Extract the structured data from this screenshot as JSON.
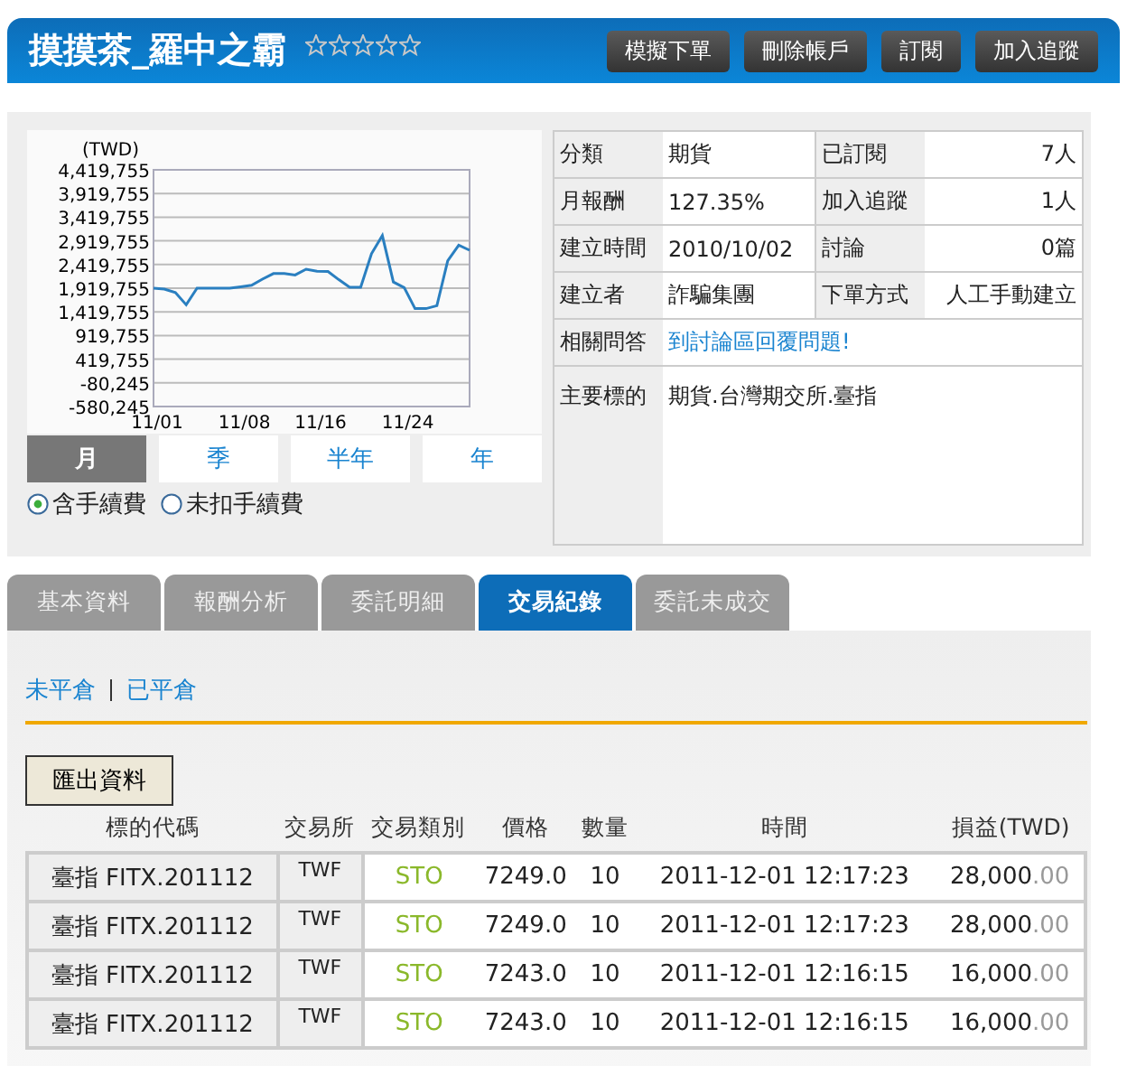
{
  "header": {
    "title": "摸摸茶_羅中之霸",
    "stars": 0,
    "buttons": [
      "模擬下單",
      "刪除帳戶",
      "訂閱",
      "加入追蹤"
    ]
  },
  "chart": {
    "chart_data": {
      "type": "line",
      "ylabel": "(TWD)",
      "categories": [
        "11/01",
        null,
        null,
        null,
        null,
        null,
        null,
        null,
        "11/08",
        null,
        null,
        null,
        null,
        null,
        null,
        "11/16",
        null,
        null,
        null,
        null,
        null,
        null,
        null,
        "11/24",
        null,
        null,
        null,
        null,
        null,
        null
      ],
      "series": [
        {
          "color": "#2a7fc0",
          "values": [
            1920000,
            1900000,
            1830000,
            1570000,
            1920000,
            1920000,
            1920000,
            1920000,
            1950000,
            1980000,
            2110000,
            2230000,
            2230000,
            2200000,
            2320000,
            2280000,
            2270000,
            2100000,
            1940000,
            1940000,
            2650000,
            3030000,
            2050000,
            1930000,
            1490000,
            1490000,
            1550000,
            2500000,
            2830000,
            2720000
          ]
        }
      ],
      "grid": true,
      "ylim": [
        -580245,
        4419755
      ],
      "yticks": [
        {
          "value": -580245,
          "label": "-580,245"
        },
        {
          "value": -80245,
          "label": "-80,245"
        },
        {
          "value": 419755,
          "label": "419,755"
        },
        {
          "value": 919755,
          "label": "919,755"
        },
        {
          "value": 1419755,
          "label": "1,419,755"
        },
        {
          "value": 1919755,
          "label": "1,919,755"
        },
        {
          "value": 2419755,
          "label": "2,419,755"
        },
        {
          "value": 2919755,
          "label": "2,919,755"
        },
        {
          "value": 3419755,
          "label": "3,419,755"
        },
        {
          "value": 3919755,
          "label": "3,919,755"
        },
        {
          "value": 4419755,
          "label": "4,419,755"
        }
      ]
    },
    "periods": [
      {
        "label": "月",
        "selected": true
      },
      {
        "label": "季",
        "selected": false
      },
      {
        "label": "半年",
        "selected": false
      },
      {
        "label": "年",
        "selected": false
      }
    ],
    "fee_options": [
      {
        "label": "含手續費",
        "selected": true
      },
      {
        "label": "未扣手續費",
        "selected": false
      }
    ]
  },
  "info": {
    "pairs": [
      {
        "label": "分類",
        "value": "期貨",
        "label2": "已訂閱",
        "value2": "7人"
      },
      {
        "label": "月報酬",
        "value": "127.35%",
        "label2": "加入追蹤",
        "value2": "1人"
      },
      {
        "label": "建立時間",
        "value": "2010/10/02",
        "label2": "討論",
        "value2": "0篇"
      },
      {
        "label": "建立者",
        "value": "詐騙集團",
        "label2": "下單方式",
        "value2": "人工手動建立"
      }
    ],
    "qa_label": "相關問答",
    "qa_link": "到討論區回覆問題!",
    "target_label": "主要標的",
    "target_value": "期貨.台灣期交所.臺指"
  },
  "tabs": [
    {
      "label": "基本資料",
      "selected": false
    },
    {
      "label": "報酬分析",
      "selected": false
    },
    {
      "label": "委託明細",
      "selected": false
    },
    {
      "label": "交易紀錄",
      "selected": true
    },
    {
      "label": "委託未成交",
      "selected": false
    }
  ],
  "sub_links": [
    "未平倉",
    "已平倉"
  ],
  "export_button": "匯出資料",
  "table": {
    "columns": [
      "標的代碼",
      "交易所",
      "交易類別",
      "價格",
      "數量",
      "時間",
      "損益(TWD)"
    ],
    "rows": [
      {
        "symbol": "臺指 FITX.201112",
        "exchange": "TWF",
        "type": "STO",
        "price": "7249.0",
        "qty": "10",
        "time": "2011-12-01 12:17:23",
        "profit": "28,000",
        "profit_fraction": ".00"
      },
      {
        "symbol": "臺指 FITX.201112",
        "exchange": "TWF",
        "type": "STO",
        "price": "7249.0",
        "qty": "10",
        "time": "2011-12-01 12:17:23",
        "profit": "28,000",
        "profit_fraction": ".00"
      },
      {
        "symbol": "臺指 FITX.201112",
        "exchange": "TWF",
        "type": "STO",
        "price": "7243.0",
        "qty": "10",
        "time": "2011-12-01 12:16:15",
        "profit": "16,000",
        "profit_fraction": ".00"
      },
      {
        "symbol": "臺指 FITX.201112",
        "exchange": "TWF",
        "type": "STO",
        "price": "7243.0",
        "qty": "10",
        "time": "2011-12-01 12:16:15",
        "profit": "16,000",
        "profit_fraction": ".00"
      }
    ]
  }
}
